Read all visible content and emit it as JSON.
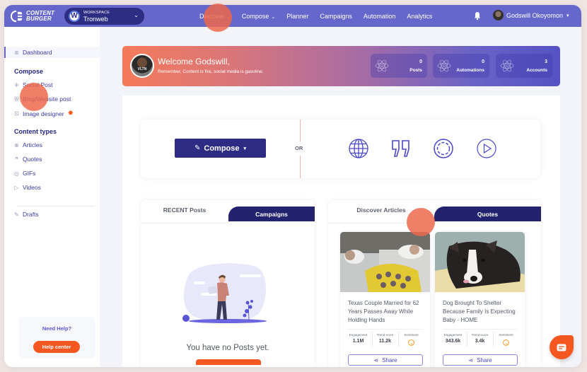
{
  "brand": {
    "line1": "CONTENT",
    "line2": "BURGER"
  },
  "workspace": {
    "label": "WORKSPACE",
    "name": "Tronweb",
    "logo_letter": "W"
  },
  "nav": {
    "items": [
      {
        "label": "Discover",
        "has_dropdown": true
      },
      {
        "label": "Compose",
        "has_dropdown": true
      },
      {
        "label": "Planner",
        "has_dropdown": false
      },
      {
        "label": "Campaigns",
        "has_dropdown": false
      },
      {
        "label": "Automation",
        "has_dropdown": false
      },
      {
        "label": "Analytics",
        "has_dropdown": false
      }
    ],
    "chevron": "⌄",
    "notification_icon": "bell-icon",
    "user_name": "Godswill Okoyomon",
    "user_caret": "▾"
  },
  "sidebar": {
    "dashboard": "Dashboard",
    "compose_heading": "Compose",
    "compose_items": [
      {
        "label": "Social Post",
        "icon": "network-icon"
      },
      {
        "label": "Blog/Website post",
        "icon": "wordpress-icon"
      },
      {
        "label": "Image designer",
        "icon": "image-icon",
        "badge": "new-star"
      }
    ],
    "content_heading": "Content types",
    "content_items": [
      {
        "label": "Articles",
        "icon": "globe-icon"
      },
      {
        "label": "Quotes",
        "icon": "quote-icon"
      },
      {
        "label": "GIFs",
        "icon": "gif-icon"
      },
      {
        "label": "Videos",
        "icon": "play-icon"
      }
    ],
    "drafts": "Drafts",
    "help_title": "Need Help?",
    "help_button": "Help center"
  },
  "welcome": {
    "title": "Welcome Godswill,",
    "subtitle": "Remember, Content is fire, social media is gasoline.",
    "avatar_text": "VLTN",
    "stats": [
      {
        "value": "0",
        "label": "Posts"
      },
      {
        "value": "0",
        "label": "Automations"
      },
      {
        "value": "3",
        "label": "Accounts"
      }
    ]
  },
  "compose_card": {
    "button_label": "Compose",
    "button_caret": "▾",
    "or_label": "OR",
    "content_type_icons": [
      "globe-icon",
      "quote-icon",
      "gif-icon",
      "play-icon"
    ]
  },
  "posts_panel": {
    "tab_active": "RECENT Posts",
    "tab_inactive": "Campaigns",
    "empty_text": "You have no Posts yet."
  },
  "discover_panel": {
    "tab_active": "Discover Articles",
    "tab_inactive": "Quotes",
    "metric_labels": [
      "Engagement",
      "Trend score",
      "Sentiment"
    ],
    "share_label": "Share",
    "articles": [
      {
        "title": "Texas Couple Married for 62 Years Passes Away While Holding Hands",
        "engagement": "1.1M",
        "trend_score": "11.2k",
        "sentiment": "positive"
      },
      {
        "title": "Dog Brought To Shelter Because Family Is Expecting Baby - HOME",
        "engagement": "343.6k",
        "trend_score": "3.4k",
        "sentiment": "positive"
      }
    ]
  },
  "colors": {
    "topbar": "#6567cb",
    "navy": "#2e2b84",
    "accent_orange": "#f4571f",
    "sidebar_text": "#3a3aa0"
  }
}
